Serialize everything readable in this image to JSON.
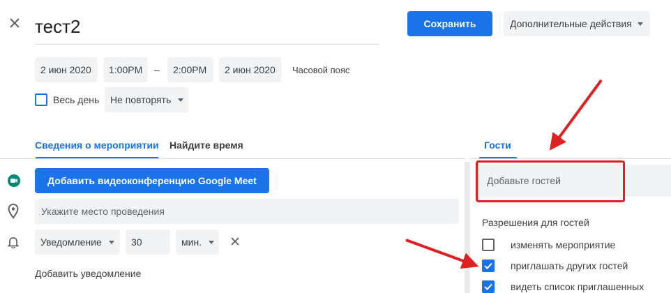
{
  "event": {
    "title": "тест2",
    "save_label": "Сохранить",
    "more_actions_label": "Дополнительные действия"
  },
  "datetime": {
    "start_date": "2 июн 2020",
    "start_time": "1:00PM",
    "dash": "–",
    "end_time": "2:00PM",
    "end_date": "2 июн 2020",
    "timezone_label": "Часовой пояс",
    "all_day_label": "Весь день",
    "repeat_label": "Не повторять"
  },
  "tabs": {
    "details": "Сведения о мероприятии",
    "find_time": "Найдите время",
    "guests": "Гости"
  },
  "details": {
    "meet_button": "Добавить видеоконференцию Google Meet",
    "location_placeholder": "Укажите место проведения",
    "notification_type": "Уведомление",
    "notification_value": "30",
    "notification_unit": "мин.",
    "add_notification": "Добавить уведомление"
  },
  "guests": {
    "add_placeholder": "Добавьте гостей",
    "permissions_title": "Разрешения для гостей",
    "permissions": [
      {
        "label": "изменять мероприятие",
        "checked": false
      },
      {
        "label": "приглашать других гостей",
        "checked": true
      },
      {
        "label": "видеть список приглашенных",
        "checked": true
      }
    ]
  },
  "colors": {
    "accent": "#1a73e8",
    "annotation_red": "#e02020",
    "meet_icon": "#00897b"
  }
}
